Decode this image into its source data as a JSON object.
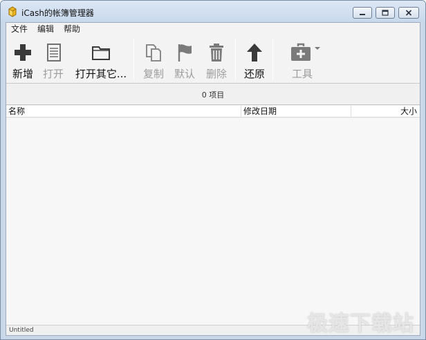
{
  "window": {
    "title": "iCash的帐簿管理器"
  },
  "menu": [
    "文件",
    "编辑",
    "帮助"
  ],
  "toolbar": {
    "new": "新增",
    "open": "打开",
    "open_other": "打开其它...",
    "copy": "复制",
    "default": "默认",
    "delete": "删除",
    "restore": "还原",
    "tools": "工具"
  },
  "list": {
    "count": "0 项目",
    "columns": {
      "name": "名称",
      "date": "修改日期",
      "size": "大小"
    }
  },
  "status": "Untitled",
  "watermark": "极速下载站"
}
